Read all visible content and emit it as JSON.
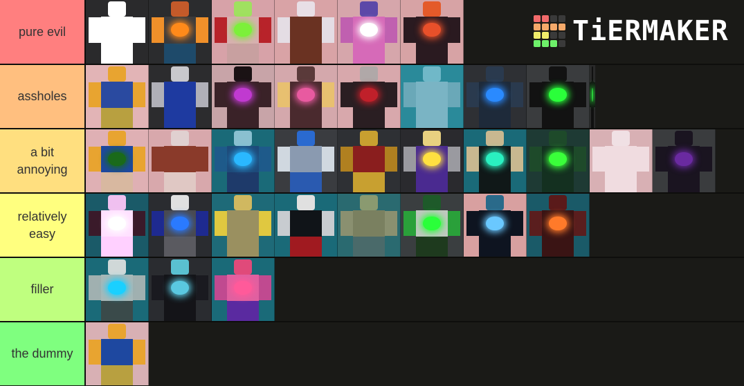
{
  "brand": {
    "name": "TiERMAKER",
    "logo_grid": [
      "#f26b6b",
      "#f26b6b",
      "#3a3a3a",
      "#3a3a3a",
      "#f5a96a",
      "#f5a96a",
      "#f5a96a",
      "#f5a96a",
      "#f0ec6a",
      "#f0ec6a",
      "#3a3a3a",
      "#3a3a3a",
      "#6ef06a",
      "#6ef06a",
      "#6ef06a",
      "#3a3a3a"
    ]
  },
  "tiers": [
    {
      "label": "pure evil",
      "color": "#ff7f7f",
      "items": [
        {
          "bg": "#2a2a2c",
          "head": "#ffffff",
          "torso": "#ffffff",
          "arms": "#ffffff",
          "legs": "#ffffff",
          "glow": ""
        },
        {
          "bg": "#2b2c2e",
          "head": "#c45a2a",
          "torso": "#3b3b3d",
          "arms": "#f0902a",
          "legs": "#1e4a6a",
          "glow": "#ff8a1a"
        },
        {
          "bg": "#d7a2a8",
          "head": "#a0e060",
          "torso": "#d8b0b0",
          "arms": "#b8232a",
          "legs": "#c8a0a0",
          "glow": "#7cf03a"
        },
        {
          "bg": "#d9a3a6",
          "head": "#e8dfe6",
          "torso": "#6a3222",
          "arms": "#e4dde4",
          "legs": "#6a3222",
          "glow": ""
        },
        {
          "bg": "#d6a6ab",
          "head": "#5c48a8",
          "torso": "#d66ab8",
          "arms": "#c060b0",
          "legs": "#d66ab8",
          "glow": "#ffffff"
        },
        {
          "bg": "#d7a3a5",
          "head": "#e45a2a",
          "torso": "#2a1a20",
          "arms": "#2a1a20",
          "legs": "#2a1a20",
          "glow": "#e8502a"
        }
      ]
    },
    {
      "label": "assholes",
      "color": "#ffbf7f",
      "items": [
        {
          "bg": "#e2b4b6",
          "head": "#e8a430",
          "torso": "#2a4aa0",
          "arms": "#e8a430",
          "legs": "#b8a040",
          "glow": ""
        },
        {
          "bg": "#2c2c2e",
          "head": "#c8c8cc",
          "torso": "#1e3aa0",
          "arms": "#b0b0b8",
          "legs": "#1e3aa0",
          "glow": ""
        },
        {
          "bg": "#c8a4a8",
          "head": "#1a1214",
          "torso": "#3a2228",
          "arms": "#3a2228",
          "legs": "#3a2228",
          "glow": "#c03ad0"
        },
        {
          "bg": "#d4a8ac",
          "head": "#5a3a3a",
          "torso": "#4a2a2e",
          "arms": "#e8c070",
          "legs": "#4a2a2e",
          "glow": "#e85aa0"
        },
        {
          "bg": "#d8a8ac",
          "head": "#b0a8a8",
          "torso": "#2a1e22",
          "arms": "#2a1e22",
          "legs": "#2a1e22",
          "glow": "#c0202a"
        },
        {
          "bg": "#2a8a9a",
          "head": "#70b8c8",
          "torso": "#7ab4c4",
          "arms": "#6aa8b8",
          "legs": "#7ab4c4",
          "glow": ""
        },
        {
          "bg": "#2e3034",
          "head": "#2a3a4e",
          "torso": "#1e2a3a",
          "arms": "#2a3a4e",
          "legs": "#1e2a3a",
          "glow": "#2a8aff"
        },
        {
          "bg": "#3a3c3e",
          "head": "#121212",
          "torso": "#121212",
          "arms": "#121212",
          "legs": "#121212",
          "glow": "#2aff3a"
        },
        {
          "bg": "#2a2a2a",
          "head": "#101010",
          "torso": "#101010",
          "arms": "#101010",
          "legs": "#101010",
          "glow": "#2ad03a",
          "narrow": true
        }
      ]
    },
    {
      "label": "a bit annoying",
      "color": "#ffdf7f",
      "items": [
        {
          "bg": "#dfb0b4",
          "head": "#e8a430",
          "torso": "#1e48a0",
          "arms": "#e8a430",
          "legs": "#d8b8a0",
          "glow": "#1a6a1a"
        },
        {
          "bg": "#d8a8ac",
          "head": "#e0d0d0",
          "torso": "#8a3a2a",
          "arms": "#8a3a2a",
          "legs": "#e0c8c4",
          "glow": ""
        },
        {
          "bg": "#1a6a78",
          "head": "#8ac0d0",
          "torso": "#1e4a7a",
          "arms": "#1e5a8a",
          "legs": "#1e3a6a",
          "glow": "#2ab8ff"
        },
        {
          "bg": "#3a3c40",
          "head": "#2a6ad0",
          "torso": "#8a9ab0",
          "arms": "#d0d8e0",
          "legs": "#2a5ab0",
          "glow": ""
        },
        {
          "bg": "#2e3034",
          "head": "#c8a030",
          "torso": "#8a1e1e",
          "arms": "#b08020",
          "legs": "#c8a030",
          "glow": ""
        },
        {
          "bg": "#2a2a2e",
          "head": "#e8d080",
          "torso": "#4a2a90",
          "arms": "#9a9aa0",
          "legs": "#4a2a90",
          "glow": "#ffe040"
        },
        {
          "bg": "#1a6a78",
          "head": "#c8b890",
          "torso": "#101818",
          "arms": "#c8b890",
          "legs": "#101818",
          "glow": "#2af0c0"
        },
        {
          "bg": "#1e3a34",
          "head": "#1e4a2a",
          "torso": "#143020",
          "arms": "#1e4a2a",
          "legs": "#143020",
          "glow": "#3aff3a"
        },
        {
          "bg": "#d8b0b4",
          "head": "#f0e0e4",
          "torso": "#f0dce0",
          "arms": "#f0dce0",
          "legs": "#f0dce0",
          "glow": ""
        },
        {
          "bg": "#3a3c3e",
          "head": "#1a1420",
          "torso": "#1a1420",
          "arms": "#1a1420",
          "legs": "#1a1420",
          "glow": "#6a2aa0"
        }
      ]
    },
    {
      "label": "relatively easy",
      "color": "#ffff7f",
      "items": [
        {
          "bg": "#1a5a68",
          "head": "#f0c0f0",
          "torso": "#ffe0ff",
          "arms": "#3a1a2a",
          "legs": "#ffd0ff",
          "glow": "#ffffff"
        },
        {
          "bg": "#2a2c30",
          "head": "#e0e0e0",
          "torso": "#4a4a50",
          "arms": "#1e2a90",
          "legs": "#5a5a60",
          "glow": "#2a7aff"
        },
        {
          "bg": "#1e6a78",
          "head": "#d0b860",
          "torso": "#9a9060",
          "arms": "#e0c840",
          "legs": "#9a9060",
          "glow": ""
        },
        {
          "bg": "#1a6a78",
          "head": "#e0e0e0",
          "torso": "#101418",
          "arms": "#c8ccd0",
          "legs": "#a01a20",
          "glow": ""
        },
        {
          "bg": "#2a6a70",
          "head": "#8a9a70",
          "torso": "#7a8060",
          "arms": "#8a9070",
          "legs": "#4a6a6a",
          "glow": ""
        },
        {
          "bg": "#3a3e40",
          "head": "#1e5a2a",
          "torso": "#c0c8c0",
          "arms": "#2aa03a",
          "legs": "#1e3a1e",
          "glow": "#2aff3a"
        },
        {
          "bg": "#d8a0a0",
          "head": "#2a6a8a",
          "torso": "#0e1420",
          "arms": "#0e1420",
          "legs": "#0e1420",
          "glow": "#6ac8ff"
        },
        {
          "bg": "#1a5a68",
          "head": "#5a1a1a",
          "torso": "#3a1414",
          "arms": "#5a1e1e",
          "legs": "#3a1414",
          "glow": "#ff7a2a"
        }
      ]
    },
    {
      "label": "filler",
      "color": "#bfff7f",
      "items": [
        {
          "bg": "#1a6a78",
          "head": "#d0d8d8",
          "torso": "#a8b8b8",
          "arms": "#a0b0b0",
          "legs": "#3a4a4a",
          "glow": "#1ad0ff"
        },
        {
          "bg": "#2a2c30",
          "head": "#5ac0d0",
          "torso": "#141418",
          "arms": "#1a1a20",
          "legs": "#141418",
          "glow": "#5ac8e0"
        },
        {
          "bg": "#1a6a78",
          "head": "#e04a7a",
          "torso": "#e060a0",
          "arms": "#c04a90",
          "legs": "#5a2aa0",
          "glow": "#ff5a9a"
        }
      ]
    },
    {
      "label": "the dummy",
      "color": "#7fff7f",
      "items": [
        {
          "bg": "#d8b0b4",
          "head": "#e8a430",
          "torso": "#1e48a0",
          "arms": "#e8a430",
          "legs": "#b8a040",
          "glow": ""
        }
      ]
    }
  ]
}
